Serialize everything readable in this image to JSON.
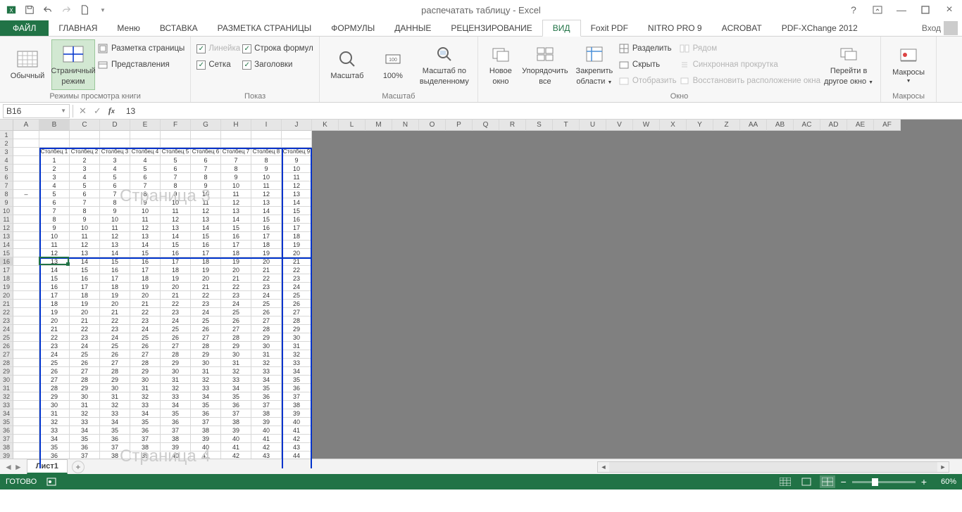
{
  "title": "распечатать таблицу - Excel",
  "signin": "Вход",
  "tabs": {
    "file": "ФАЙЛ",
    "home": "ГЛАВНАЯ",
    "menu": "Меню",
    "insert": "ВСТАВКА",
    "layout": "РАЗМЕТКА СТРАНИЦЫ",
    "formulas": "ФОРМУЛЫ",
    "data": "ДАННЫЕ",
    "review": "РЕЦЕНЗИРОВАНИЕ",
    "view": "ВИД",
    "foxit": "Foxit PDF",
    "nitro": "NITRO PRO 9",
    "acrobat": "ACROBAT",
    "pdfx": "PDF-XChange 2012"
  },
  "ribbon": {
    "normal": "Обычный",
    "pagebreak1": "Страничный",
    "pagebreak2": "режим",
    "pagelayout": "Разметка страницы",
    "customviews": "Представления",
    "ruler": "Линейка",
    "formulabar": "Строка формул",
    "gridlines": "Сетка",
    "headings": "Заголовки",
    "zoom": "Масштаб",
    "z100": "100%",
    "zoomsel1": "Масштаб по",
    "zoomsel2": "выделенному",
    "newwin1": "Новое",
    "newwin2": "окно",
    "arrange1": "Упорядочить",
    "arrange2": "все",
    "freeze1": "Закрепить",
    "freeze2": "области",
    "split": "Разделить",
    "hide": "Скрыть",
    "unhide": "Отобразить",
    "sidebyside": "Рядом",
    "syncscroll": "Синхронная прокрутка",
    "resetpos": "Восстановить расположение окна",
    "switch1": "Перейти в",
    "switch2": "другое окно",
    "macros": "Макросы",
    "g_views": "Режимы просмотра книги",
    "g_show": "Показ",
    "g_zoom": "Масштаб",
    "g_window": "Окно",
    "g_macros": "Макросы"
  },
  "namebox": "B16",
  "formula": "13",
  "cols": [
    "A",
    "B",
    "C",
    "D",
    "E",
    "F",
    "G",
    "H",
    "I",
    "J",
    "K",
    "L",
    "M",
    "N",
    "O",
    "P",
    "Q",
    "R",
    "S",
    "T",
    "U",
    "V",
    "W",
    "X",
    "Y",
    "Z",
    "AA",
    "AB",
    "AC",
    "AD",
    "AE",
    "AF"
  ],
  "colHeaders": [
    "Столбец 1",
    "Столбец 2",
    "Столбец 3",
    "Столбец 4",
    "Столбец 5",
    "Столбец 6",
    "Столбец 7",
    "Столбец 8",
    "Столбец 9"
  ],
  "rowCount": 40,
  "dataStartRow": 3,
  "dataStartVal_B": 1,
  "wm1": "Страница 3",
  "wm2": "Страница 4",
  "sheet": "Лист1",
  "status": "ГОТОВО",
  "zoom": "60%"
}
